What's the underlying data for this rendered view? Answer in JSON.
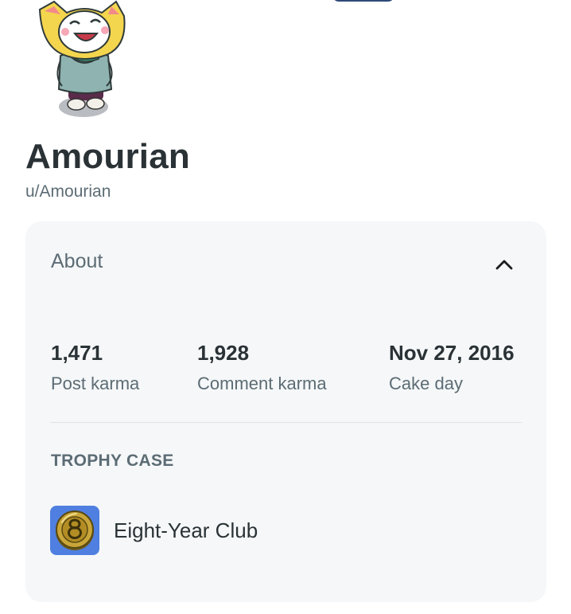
{
  "profile": {
    "display_name": "Amourian",
    "username": "u/Amourian"
  },
  "about": {
    "title": "About",
    "collapse_icon": "chevron-up-icon",
    "stats": [
      {
        "value": "1,471",
        "label": "Post karma"
      },
      {
        "value": "1,928",
        "label": "Comment karma"
      },
      {
        "value": "Nov 27, 2016",
        "label": "Cake day"
      }
    ],
    "trophy_case": {
      "heading": "TROPHY CASE",
      "trophies": [
        {
          "name": "Eight-Year Club",
          "icon": "eight-year-club-coin-icon"
        }
      ]
    }
  },
  "colors": {
    "card_background": "#f5f7f9",
    "primary_text": "#2a3236",
    "secondary_text": "#5c6c74",
    "trophy_background": "#4f7fe0"
  }
}
